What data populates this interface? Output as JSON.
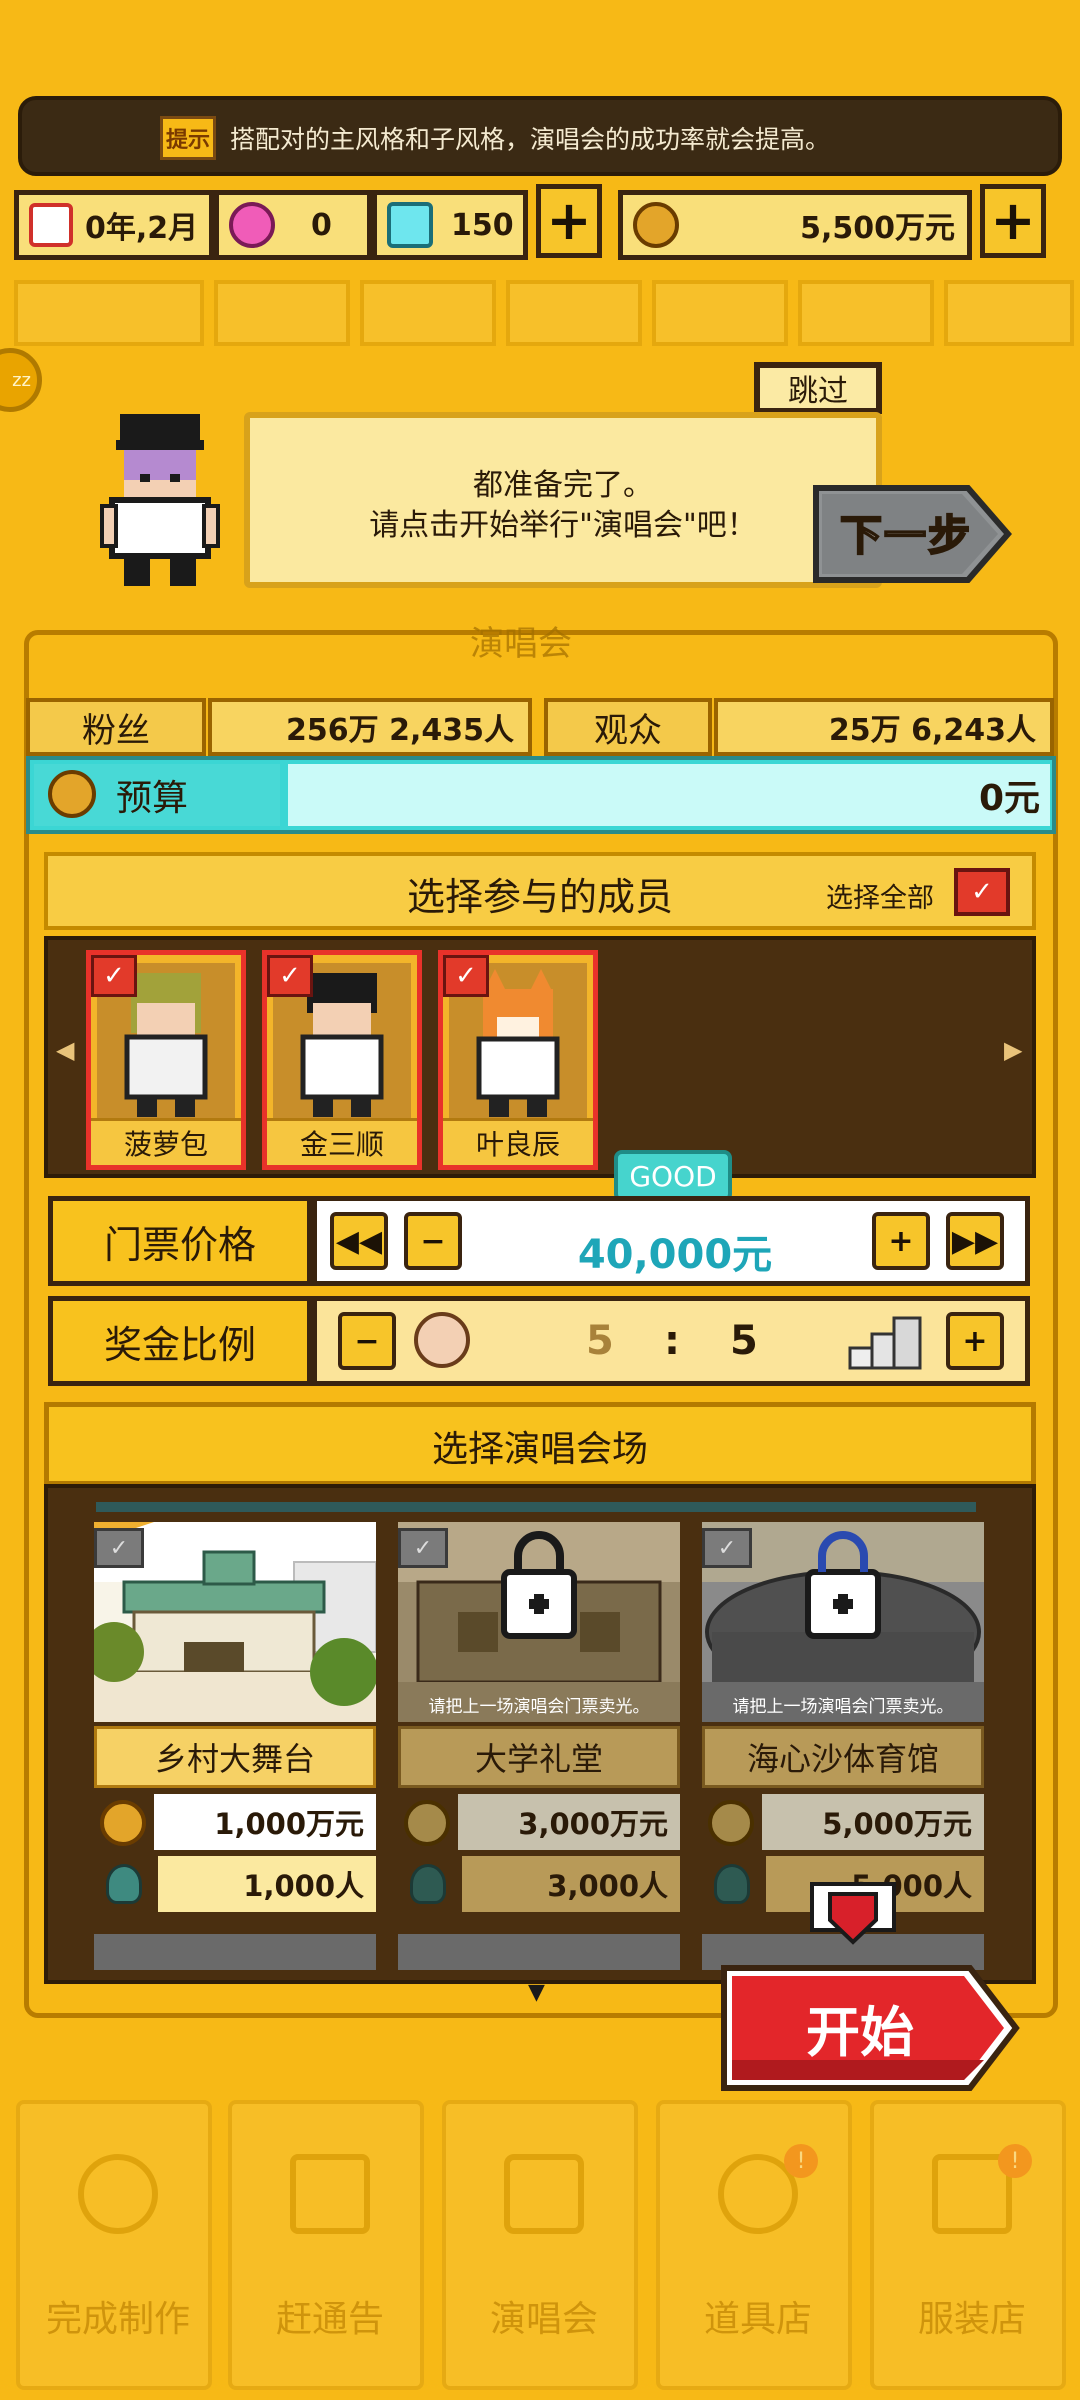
{
  "tip": {
    "badge": "提示",
    "text": "搭配对的主风格和子风格，演唱会的成功率就会提高。"
  },
  "resources": {
    "date": "0年,2月",
    "gem_pink": "0",
    "gem_blue": "150",
    "money": "5,500万元"
  },
  "dialog": {
    "skip": "跳过",
    "line1": "都准备完了。",
    "line2": "请点击开始举行\"演唱会\"吧！",
    "next": "下一步"
  },
  "concert_label": "演唱会",
  "stats": {
    "fans_label": "粉丝",
    "fans_value": "256万 2,435人",
    "audience_label": "观众",
    "audience_value": "25万 6,243人"
  },
  "budget": {
    "label": "预算",
    "value": "0元"
  },
  "members": {
    "title": "选择参与的成员",
    "select_all": "选择全部",
    "list": [
      {
        "name": "菠萝包"
      },
      {
        "name": "金三顺"
      },
      {
        "name": "叶良辰"
      }
    ]
  },
  "ticket": {
    "label": "门票价格",
    "rating": "GOOD",
    "value": "40,000元"
  },
  "bonus": {
    "label": "奖金比例",
    "left": "5",
    "separator": ":",
    "right": "5"
  },
  "venues": {
    "title": "选择演唱会场",
    "list": [
      {
        "name": "乡村大舞台",
        "cost": "1,000万元",
        "capacity": "1,000人",
        "locked": false
      },
      {
        "name": "大学礼堂",
        "cost": "3,000万元",
        "capacity": "3,000人",
        "locked": true,
        "lock_text": "请把上一场演唱会门票卖光。"
      },
      {
        "name": "海心沙体育馆",
        "cost": "5,000万元",
        "capacity": "5,000人",
        "locked": true,
        "lock_text": "请把上一场演唱会门票卖光。"
      }
    ]
  },
  "start": "开始",
  "nav": [
    "完成制作",
    "赶通告",
    "演唱会",
    "道具店",
    "服装店"
  ],
  "colors": {
    "accent": "#f7b916",
    "start_red": "#e3262a",
    "teal": "#3bd6d4"
  }
}
